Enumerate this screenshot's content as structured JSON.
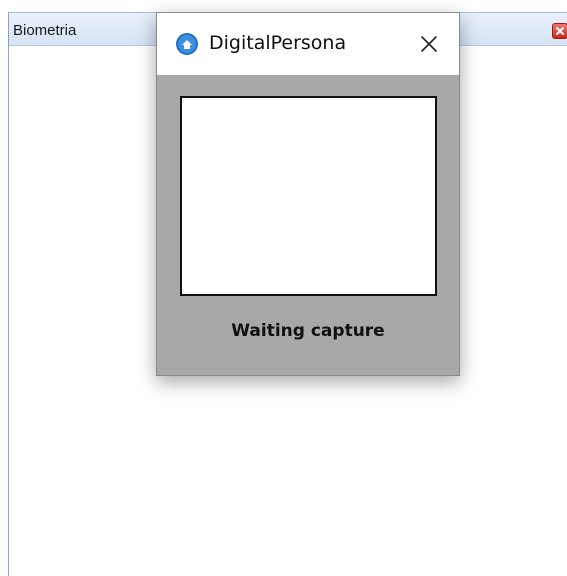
{
  "background_window": {
    "title": "Biometria",
    "close_icon": "close-x-red-icon"
  },
  "dialog": {
    "title": "DigitalPersona",
    "app_icon": "digitalpersona-logo-icon",
    "close_icon": "close-x-icon",
    "status": "Waiting capture"
  },
  "colors": {
    "dialog_body": "#a8a8a8",
    "titlebar_blue": "#d6e3f4",
    "close_red": "#c8261a",
    "logo_blue": "#1f6fc4"
  }
}
